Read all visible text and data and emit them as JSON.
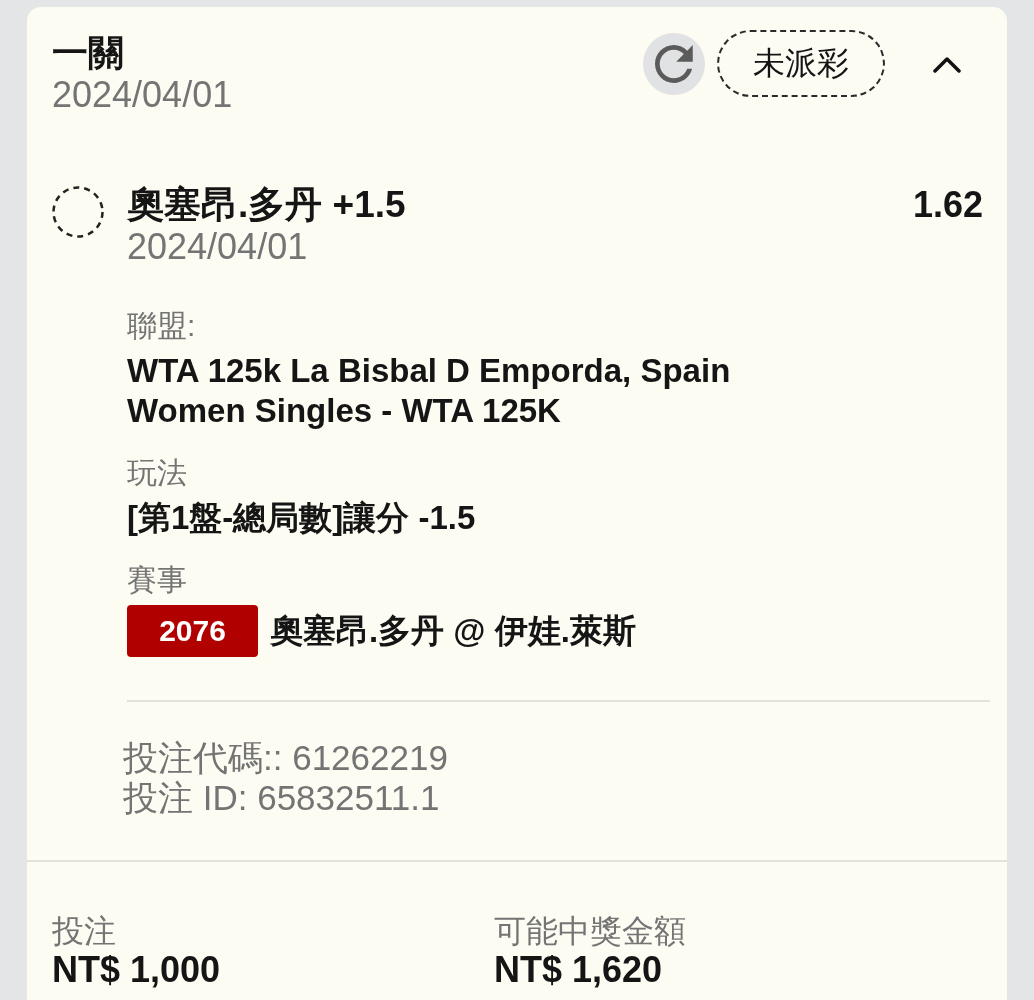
{
  "bet_card": {
    "title": "一關",
    "date": "2024/04/01",
    "status": "未派彩",
    "expanded": true
  },
  "selection": {
    "settled": false,
    "name": "奧塞昂.多丹 +1.5",
    "odds": "1.62",
    "date": "2024/04/01",
    "details": [
      {
        "label": "聯盟:",
        "lines": [
          "WTA 125k La Bisbal D Emporda, Spain",
          "Women Singles - WTA 125K"
        ]
      },
      {
        "label": "玩法",
        "lines": [
          "[第1盤-總局數]讓分 -1.5"
        ]
      },
      {
        "label": "賽事",
        "match_number": "2076",
        "lines": [
          "奧塞昂.多丹 @ 伊娃.萊斯"
        ]
      }
    ]
  },
  "bet_ids": [
    "投注代碼:: 61262219",
    "投注 ID: 65832511.1"
  ],
  "summary": [
    {
      "label": "投注",
      "value": "NT$ 1,000"
    },
    {
      "label": "可能中獎金額",
      "value": "NT$ 1,620"
    }
  ]
}
